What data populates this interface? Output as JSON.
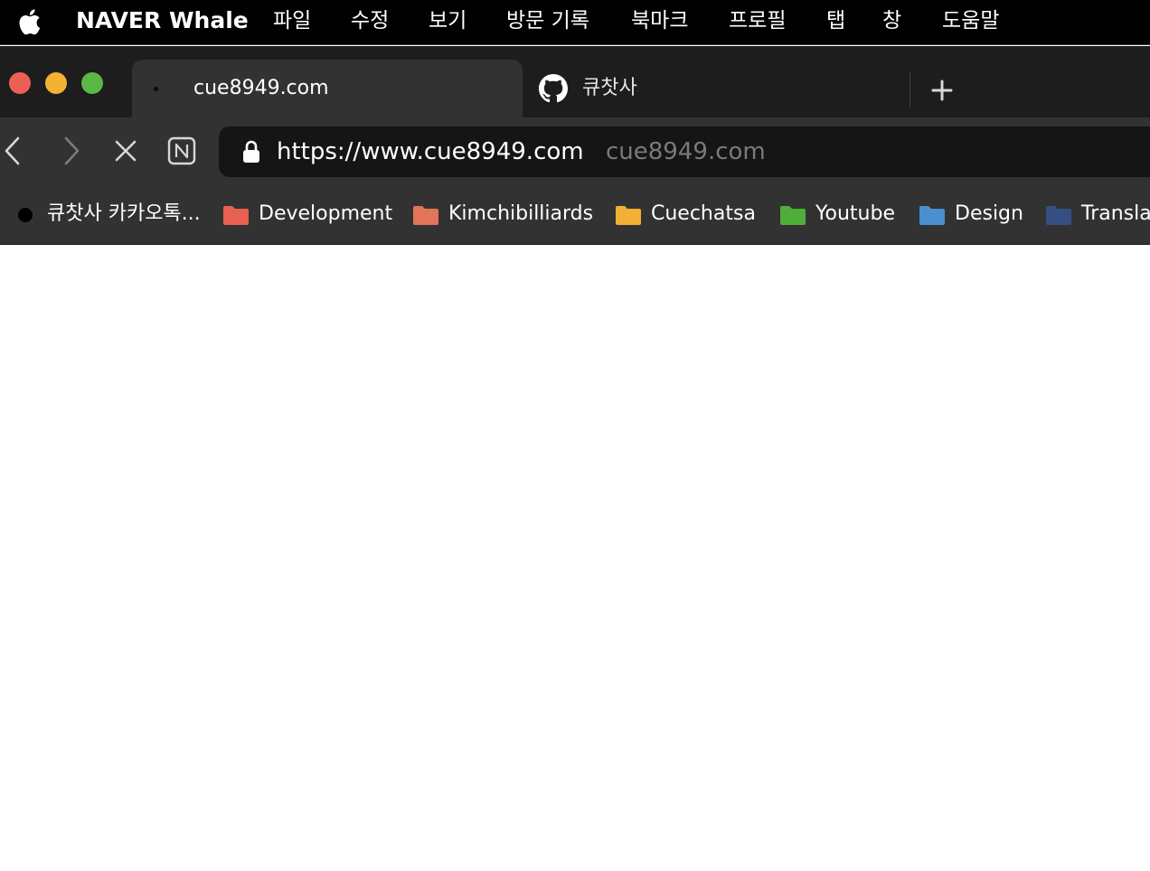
{
  "menubar": {
    "app_name": "NAVER Whale",
    "items": [
      "파일",
      "수정",
      "보기",
      "방문 기록",
      "북마크",
      "프로필",
      "탭",
      "창",
      "도움말"
    ]
  },
  "tabs": [
    {
      "title": "cue8949.com",
      "active": true
    },
    {
      "title": "큐찻사",
      "icon": "github-icon",
      "active": false
    }
  ],
  "toolbar": {
    "url": "https://www.cue8949.com",
    "host": "cue8949.com"
  },
  "bookmarks": [
    {
      "label": "큐찻사 카카오톡...",
      "icon": "dot-icon"
    },
    {
      "label": "Development",
      "icon": "folder-icon",
      "color": "#e8604f"
    },
    {
      "label": "Kimchibilliards",
      "icon": "folder-icon",
      "color": "#e27458"
    },
    {
      "label": "Cuechatsa",
      "icon": "folder-icon",
      "color": "#f2b035"
    },
    {
      "label": "Youtube",
      "icon": "folder-icon",
      "color": "#4fad3a"
    },
    {
      "label": "Design",
      "icon": "folder-icon",
      "color": "#4a8fd0"
    },
    {
      "label": "Translation",
      "icon": "folder-icon",
      "color": "#354f83"
    }
  ],
  "colors": {
    "menubar_bg": "#000000",
    "tabstrip_bg": "#1d1d1d",
    "toolbar_bg": "#323232",
    "urlbar_bg": "#151515",
    "traffic_red": "#ec5f57",
    "traffic_yellow": "#f4b234",
    "traffic_green": "#5ab847"
  }
}
